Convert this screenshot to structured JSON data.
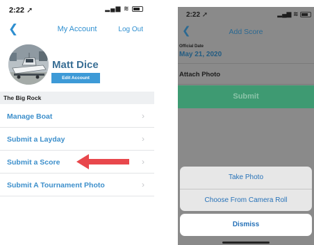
{
  "left": {
    "status": {
      "time": "2:22",
      "location_icon": "location-arrow-icon",
      "signal_icon": "signal-bars-icon",
      "wifi_icon": "wifi-icon",
      "battery_icon": "battery-icon"
    },
    "nav": {
      "back_icon": "chevron-left-icon",
      "title": "My Account",
      "logout": "Log Out"
    },
    "profile": {
      "name": "Matt Dice",
      "edit_label": "Edit Account",
      "avatar_icon": "boat-photo"
    },
    "section": "The Big Rock",
    "menu": [
      {
        "label": "Manage Boat"
      },
      {
        "label": "Submit a Layday"
      },
      {
        "label": "Submit a Score"
      },
      {
        "label": "Submit A Tournament Photo"
      }
    ],
    "annotation": {
      "arrow_icon": "red-arrow-left-icon",
      "color": "#e8474c"
    }
  },
  "right": {
    "status": {
      "time": "2:22"
    },
    "nav": {
      "title": "Add Score"
    },
    "fields": {
      "date_label": "Official Date",
      "date_value": "May 21, 2020",
      "photo_label": "Attach Photo"
    },
    "submit_label": "Submit",
    "sheet": {
      "take_photo": "Take Photo",
      "camera_roll": "Choose From Camera Roll",
      "dismiss": "Dismiss"
    }
  },
  "colors": {
    "accent": "#2f8fd0",
    "menu_text": "#3d8fcb",
    "submit_green": "#3e9a72",
    "arrow_red": "#e8474c"
  }
}
